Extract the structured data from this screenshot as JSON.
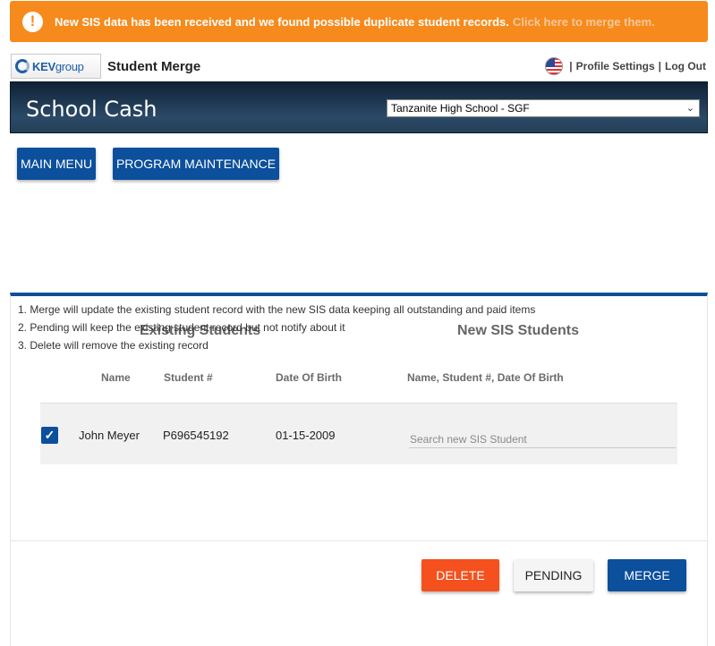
{
  "alert": {
    "icon": "exclamation-icon",
    "message": "New SIS data has been received and we found possible duplicate student records.",
    "link": "Click here to merge them.",
    "color": "#f68a1c"
  },
  "header": {
    "logo_text_bold": "KEV",
    "logo_text_thin": "group",
    "page_name": "Student Merge",
    "profile_settings": "Profile Settings",
    "log_out": "Log Out",
    "separator": "|"
  },
  "banner": {
    "title": "School Cash",
    "school_selected": "Tanzanite High School - SGF"
  },
  "nav": {
    "main_menu": "MAIN MENU",
    "program_maintenance": "PROGRAM MAINTENANCE"
  },
  "merge": {
    "existing_title": "Existing Students",
    "new_title": "New SIS Students",
    "columns": {
      "name": "Name",
      "student_no": "Student #",
      "dob": "Date Of Birth",
      "new_combined": "Name, Student #, Date Of Birth"
    },
    "rows": [
      {
        "checked": true,
        "name": "John Meyer",
        "student_no": "P696545192",
        "dob": "01-15-2009",
        "search_placeholder": "Search new SIS Student"
      }
    ]
  },
  "actions": {
    "delete": "DELETE",
    "pending": "PENDING",
    "merge": "MERGE",
    "delete_color": "#f4511e",
    "primary_color": "#0c4f9c"
  },
  "notes": [
    "1. Merge will update the existing student record with the new SIS data keeping all outstanding and paid items",
    "2. Pending will keep the existing student record but not notify about it",
    "3. Delete will remove the existing record"
  ]
}
